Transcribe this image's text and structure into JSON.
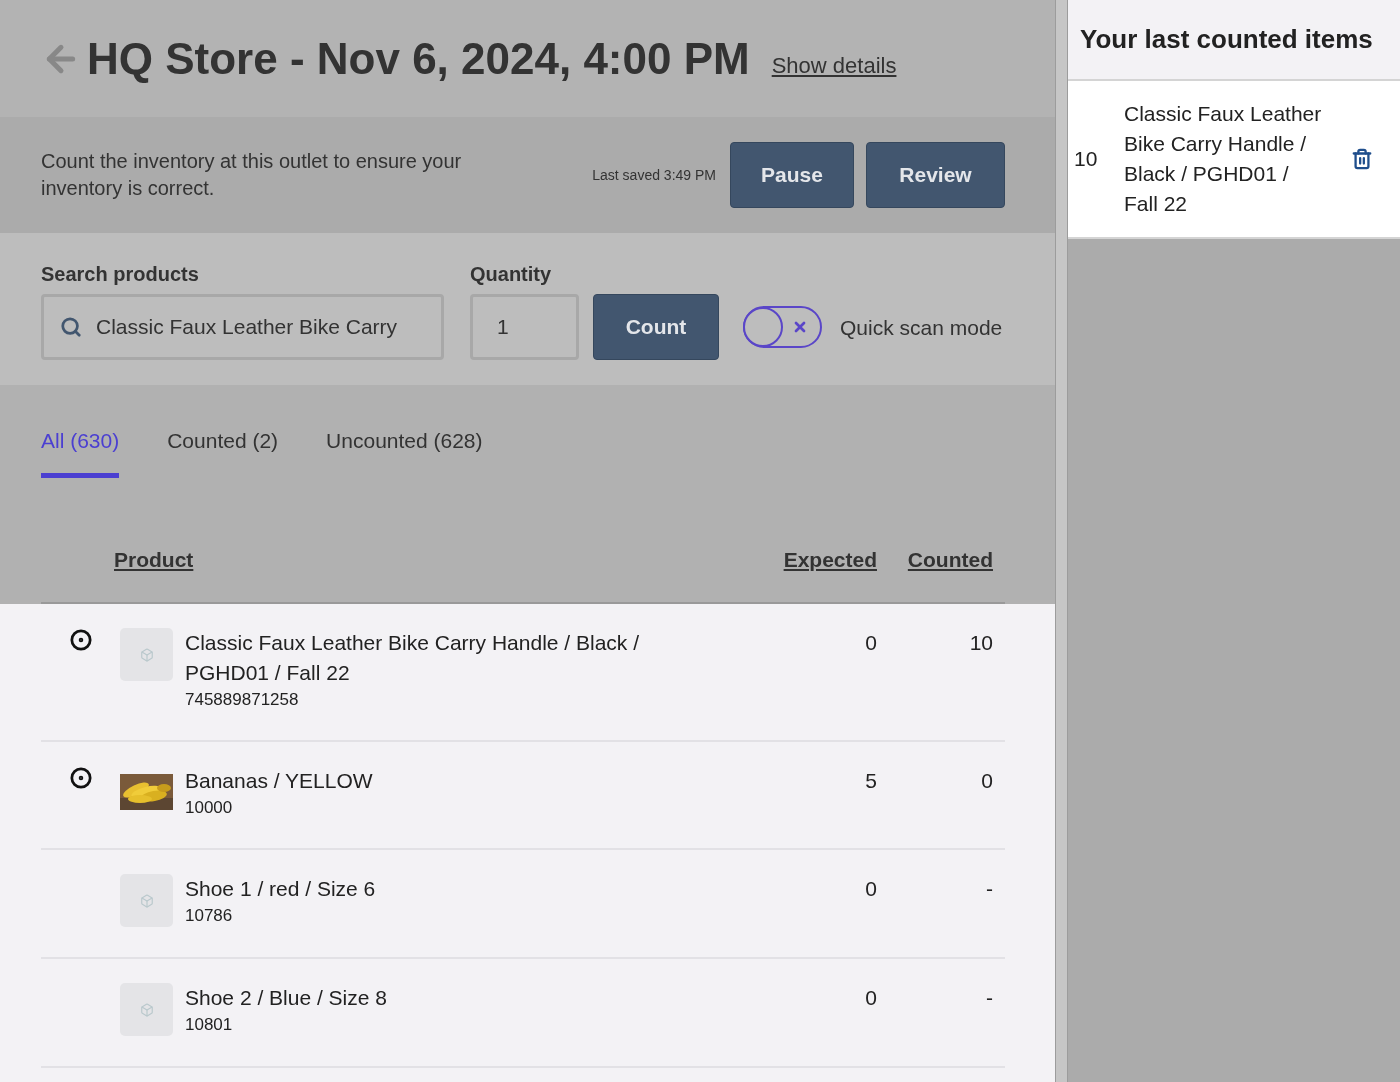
{
  "header": {
    "title": "HQ Store - Nov 6, 2024, 4:00 PM",
    "details_link": "Show details"
  },
  "banner": {
    "message": "Count the inventory at this outlet to ensure your inventory is correct.",
    "last_saved": "Last saved 3:49 PM",
    "buttons": [
      "Pause",
      "Review"
    ]
  },
  "search": {
    "label": "Search products",
    "value": "Classic Faux Leather Bike Carry",
    "quantity_label": "Quantity",
    "quantity": "1",
    "count_button": "Count",
    "quick_scan": {
      "label": "Quick scan mode",
      "on": false
    }
  },
  "tabs": [
    {
      "label": "All (630)",
      "selected": true
    },
    {
      "label": "Counted (2)",
      "selected": false
    },
    {
      "label": "Uncounted (628)",
      "selected": false
    }
  ],
  "table": {
    "columns": [
      "Product",
      "Expected",
      "Counted"
    ],
    "rows": [
      {
        "name": "Classic Faux Leather Bike Carry Handle / Black / PGHD01 / Fall 22",
        "code": "745889871258",
        "expected": "0",
        "counted": "10",
        "flagged": true,
        "kind": "placeholder"
      },
      {
        "name": "Bananas / YELLOW",
        "code": "10000",
        "expected": "5",
        "counted": "0",
        "flagged": true,
        "kind": "picture"
      },
      {
        "name": "Shoe 1 / red / Size 6",
        "code": "10786",
        "expected": "0",
        "counted": "-",
        "flagged": false,
        "kind": "placeholder"
      },
      {
        "name": "Shoe 2 / Blue / Size 8",
        "code": "10801",
        "expected": "0",
        "counted": "-",
        "flagged": false,
        "kind": "placeholder"
      }
    ]
  },
  "sidebar": {
    "title": "Your last counted items",
    "items": [
      {
        "quantity": "10",
        "name": "Classic Faux Leather Bike Carry Handle / Black / PGHD01 / Fall 22"
      }
    ]
  }
}
